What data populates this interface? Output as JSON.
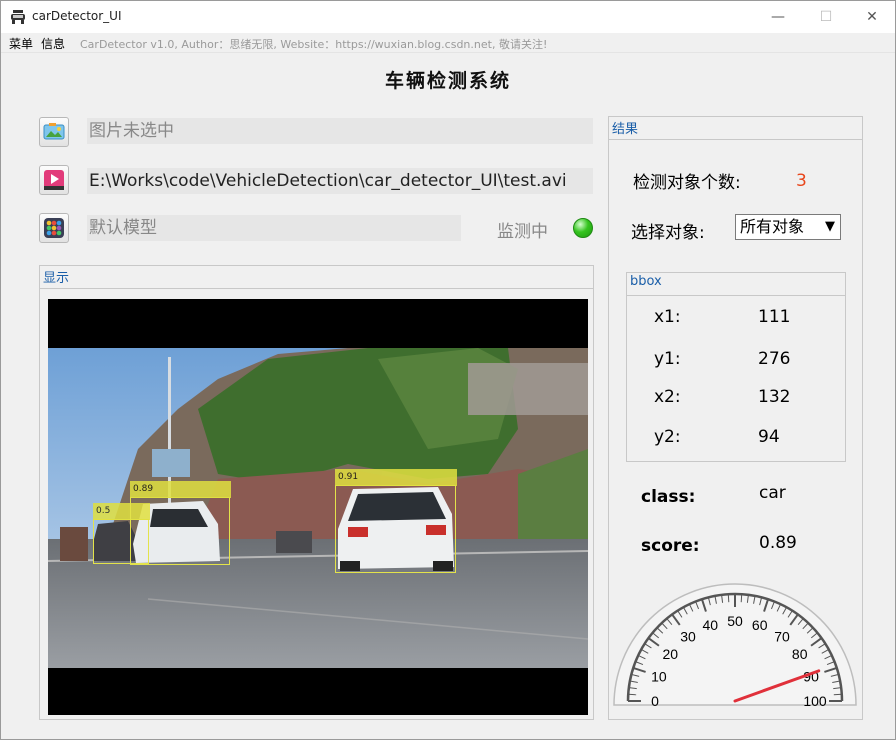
{
  "window": {
    "title": "carDetector_UI",
    "minimize": "—",
    "maximize": "☐",
    "close": "✕"
  },
  "menu": {
    "items": [
      "菜单",
      "信息"
    ],
    "author": "CarDetector v1.0, Author：思绪无限, Website：https://wuxian.blog.csdn.net, 敬请关注!"
  },
  "main_title": "车辆检测系统",
  "controls": {
    "image_field": "图片未选中",
    "video_field": "E:\\Works\\code\\VehicleDetection\\car_detector_UI\\test.avi",
    "model_field": "默认模型",
    "status_label": "监测中",
    "status_color": "#35c41f"
  },
  "display": {
    "group_title": "显示",
    "detections": [
      {
        "score": "0.5"
      },
      {
        "score": "0.89"
      },
      {
        "score": "0.91"
      }
    ]
  },
  "result": {
    "group_title": "结果",
    "count_label": "检测对象个数:",
    "count_value": "3",
    "count_color": "#e8461b",
    "select_label": "选择对象:",
    "select_value": "所有对象",
    "bbox": {
      "title": "bbox",
      "x1_label": "x1:",
      "x1": "111",
      "y1_label": "y1:",
      "y1": "276",
      "x2_label": "x2:",
      "x2": "132",
      "y2_label": "y2:",
      "y2": "94"
    },
    "class_label": "class:",
    "class_value": "car",
    "score_label": "score:",
    "score_value": "0.89"
  },
  "gauge": {
    "value": 89,
    "min": 0,
    "max": 100,
    "tick_labels": [
      "0",
      "10",
      "20",
      "30",
      "40",
      "50",
      "60",
      "70",
      "80",
      "90",
      "100"
    ],
    "needle_color": "#e0303a"
  }
}
